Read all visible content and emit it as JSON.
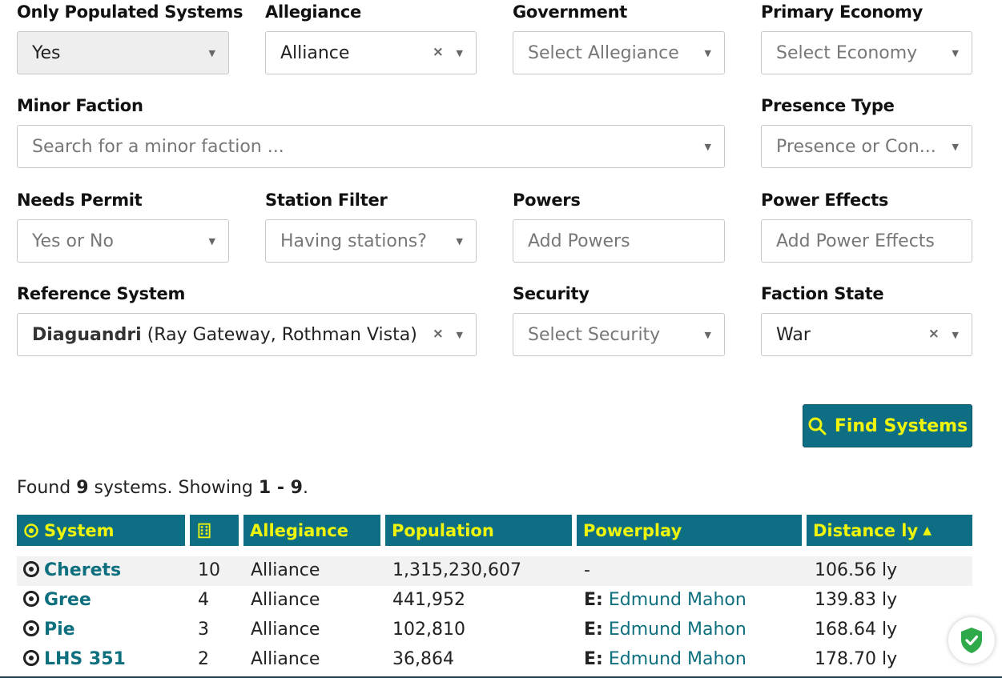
{
  "filters": {
    "populated": {
      "label": "Only Populated Systems",
      "value": "Yes"
    },
    "allegiance": {
      "label": "Allegiance",
      "value": "Alliance",
      "clear": "×"
    },
    "government": {
      "label": "Government",
      "placeholder": "Select Allegiance"
    },
    "economy": {
      "label": "Primary Economy",
      "placeholder": "Select Economy"
    },
    "minor_faction": {
      "label": "Minor Faction",
      "placeholder": "Search for a minor faction ..."
    },
    "presence": {
      "label": "Presence Type",
      "placeholder": "Presence or Con..."
    },
    "permit": {
      "label": "Needs Permit",
      "placeholder": "Yes or No"
    },
    "station": {
      "label": "Station Filter",
      "placeholder": "Having stations?"
    },
    "powers": {
      "label": "Powers",
      "placeholder": "Add Powers"
    },
    "power_effects": {
      "label": "Power Effects",
      "placeholder": "Add Power Effects"
    },
    "reference": {
      "label": "Reference System",
      "system": "Diaguandri",
      "stations": "(Ray Gateway, Rothman Vista)",
      "clear": "×"
    },
    "security": {
      "label": "Security",
      "placeholder": "Select Security"
    },
    "faction_state": {
      "label": "Faction State",
      "value": "War",
      "clear": "×"
    }
  },
  "find_button": "Find Systems",
  "results": {
    "prefix": "Found ",
    "count": "9",
    "mid": " systems. Showing ",
    "range": "1 - 9",
    "suffix": "."
  },
  "columns": {
    "system": "System",
    "allegiance": "Allegiance",
    "population": "Population",
    "powerplay": "Powerplay",
    "distance": "Distance ly",
    "sort_arrow": "▲"
  },
  "rows": [
    {
      "system": "Cherets",
      "stations": "10",
      "allegiance": "Alliance",
      "population": "1,315,230,607",
      "pp_prefix": "",
      "power": "-",
      "distance": "106.56 ly"
    },
    {
      "system": "Gree",
      "stations": "4",
      "allegiance": "Alliance",
      "population": "441,952",
      "pp_prefix": "E",
      "power": "Edmund Mahon",
      "distance": "139.83 ly"
    },
    {
      "system": "Pie",
      "stations": "3",
      "allegiance": "Alliance",
      "population": "102,810",
      "pp_prefix": "E",
      "power": "Edmund Mahon",
      "distance": "168.64 ly"
    },
    {
      "system": "LHS 351",
      "stations": "2",
      "allegiance": "Alliance",
      "population": "36,864",
      "pp_prefix": "E",
      "power": "Edmund Mahon",
      "distance": "178.70 ly"
    }
  ],
  "colors": {
    "accent": "#0e6f84",
    "header_text": "#eef40c",
    "link": "#0e6f7e",
    "shield": "#2eaa4a"
  },
  "icons": {
    "caret": "chevron-down-icon",
    "search": "search-icon",
    "target": "target-icon",
    "building": "building-icon",
    "shield": "shield-check-icon"
  }
}
